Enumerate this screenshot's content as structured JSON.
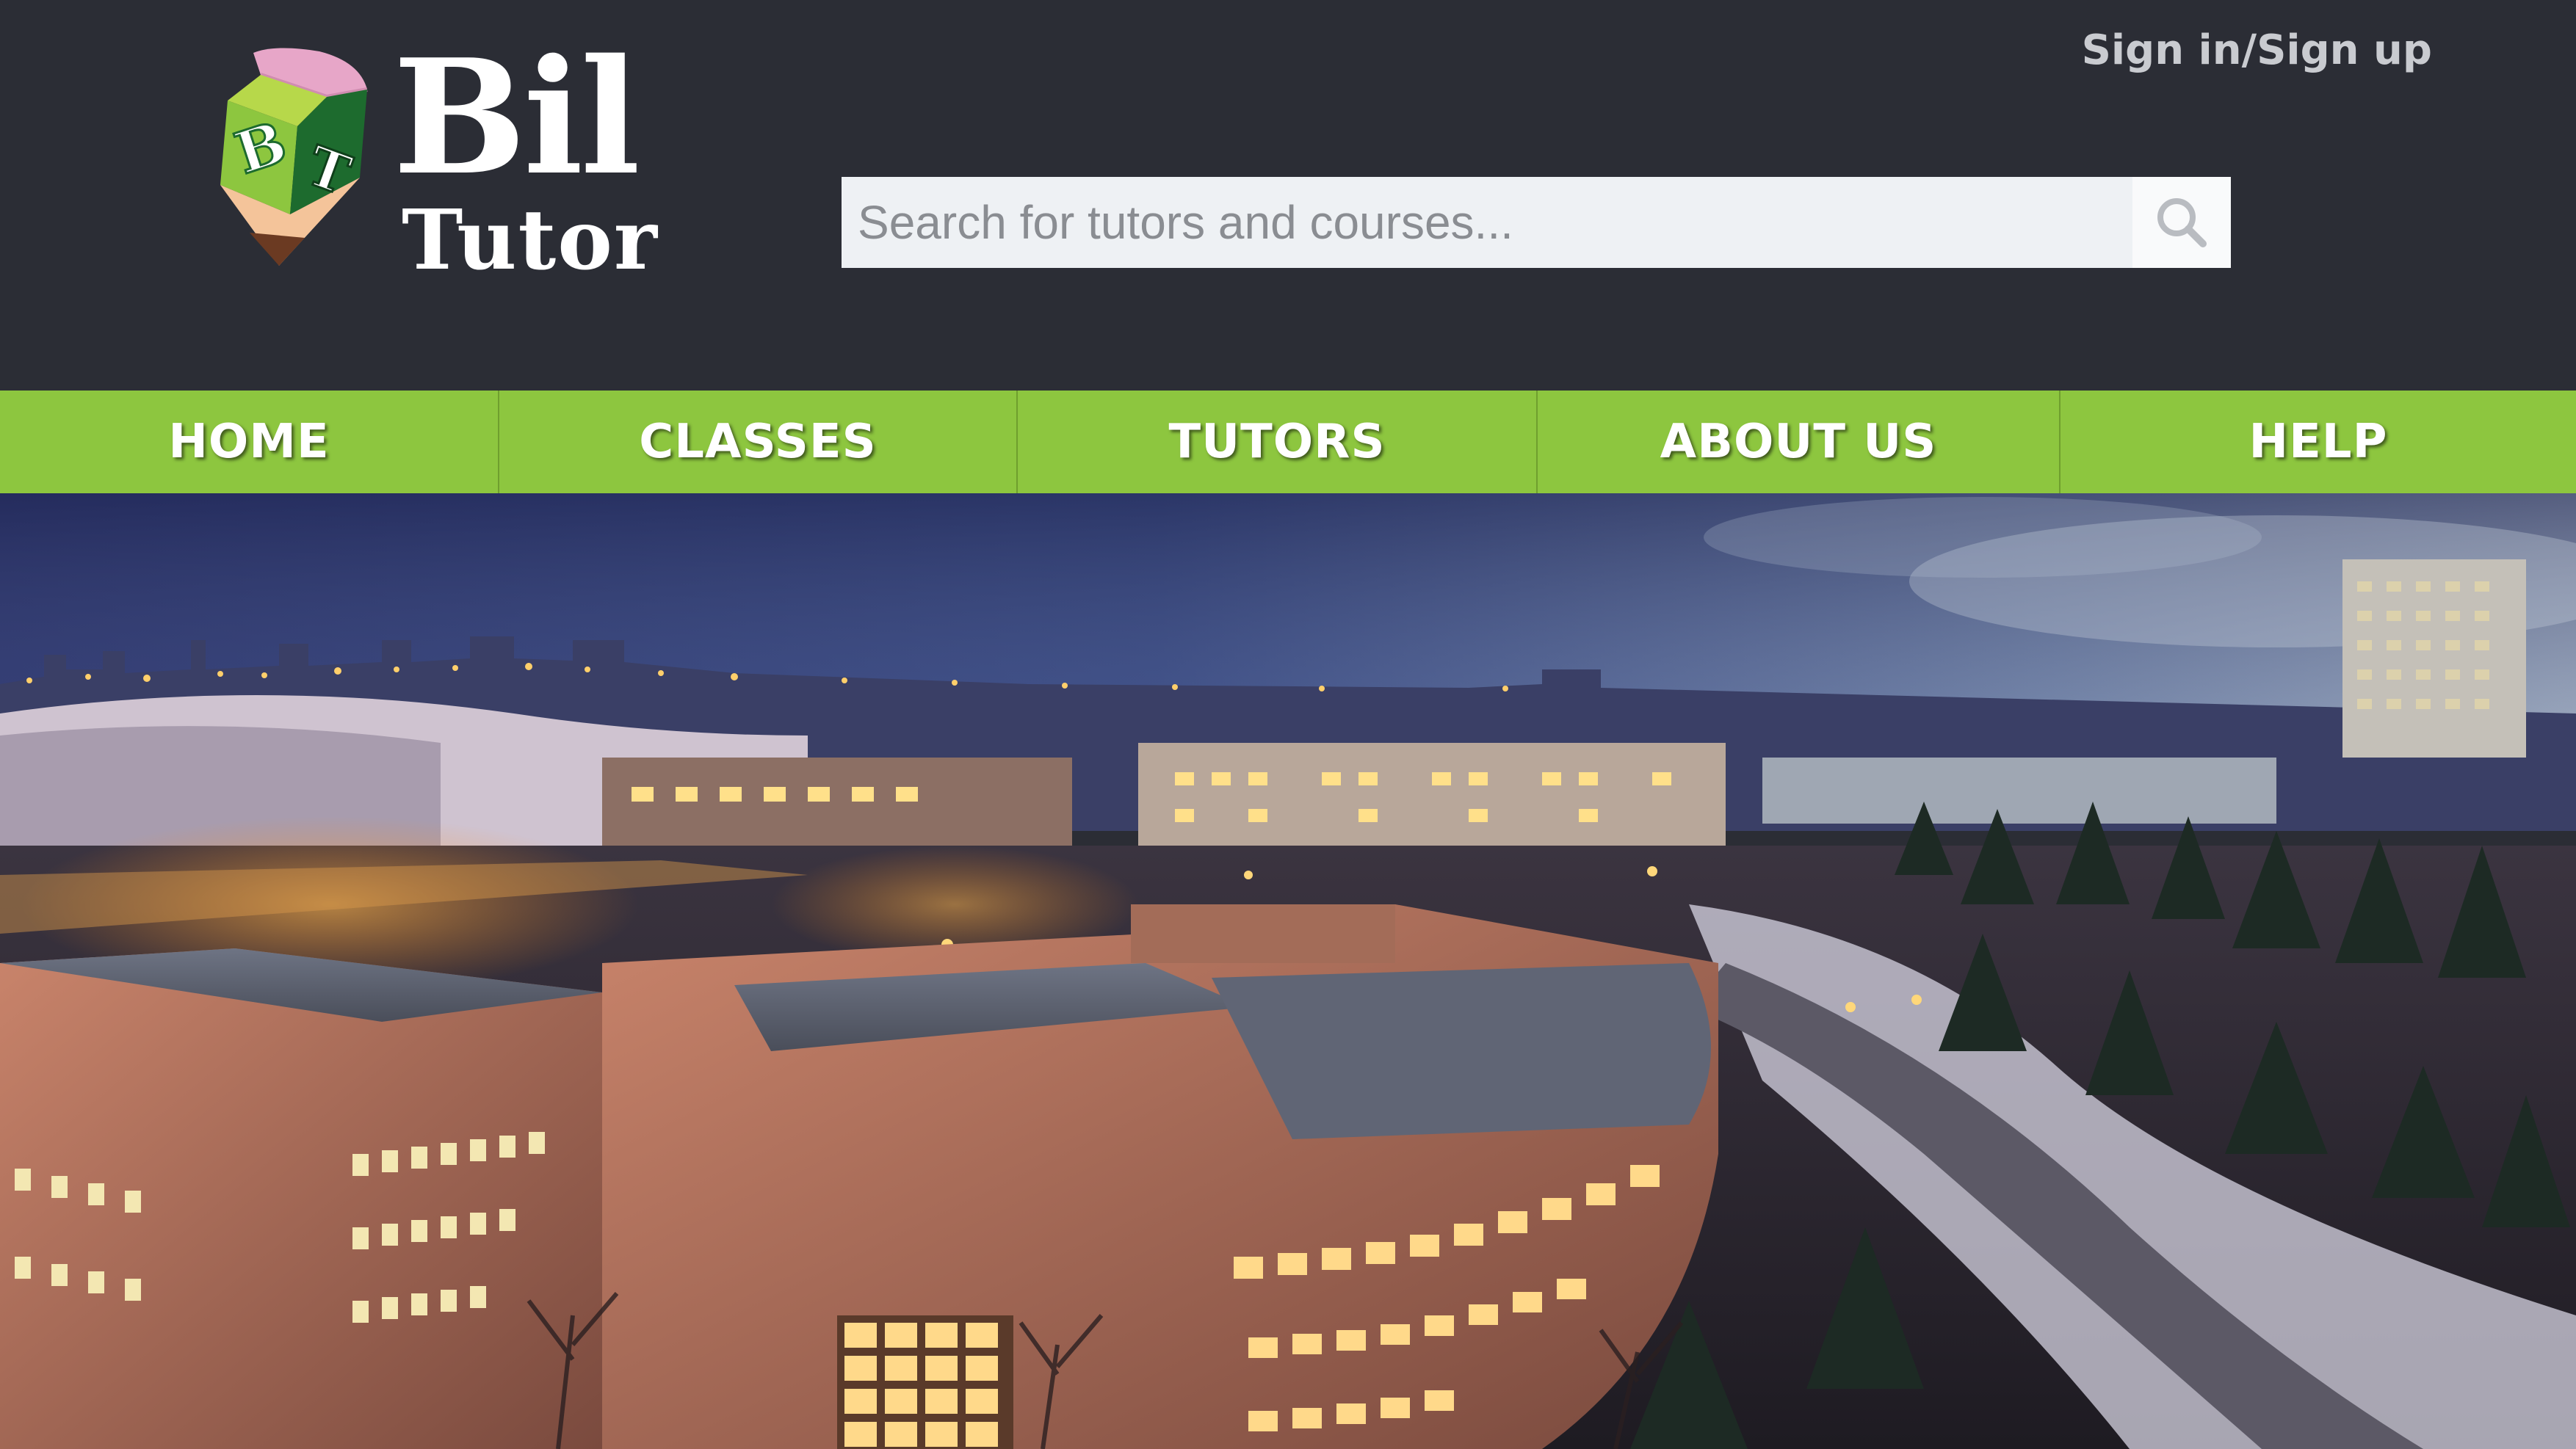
{
  "header": {
    "logo": {
      "badge_letters": [
        "B",
        "T"
      ],
      "word_1": "Bil",
      "word_2": "Tutor"
    },
    "signin_label": "Sign in/Sign up",
    "search": {
      "placeholder": "Search for tutors and courses...",
      "value": "",
      "icon": "search-icon"
    }
  },
  "nav": {
    "items": [
      {
        "label": "HOME"
      },
      {
        "label": "CLASSES"
      },
      {
        "label": "TUTORS"
      },
      {
        "label": "ABOUT US"
      },
      {
        "label": "HELP"
      }
    ]
  },
  "hero": {
    "image": "campus-night-panorama"
  },
  "colors": {
    "header_bg": "#2b2d35",
    "nav_green": "#8dc63f",
    "search_bg": "#eef1f4",
    "text_light": "#c9cbd0"
  }
}
